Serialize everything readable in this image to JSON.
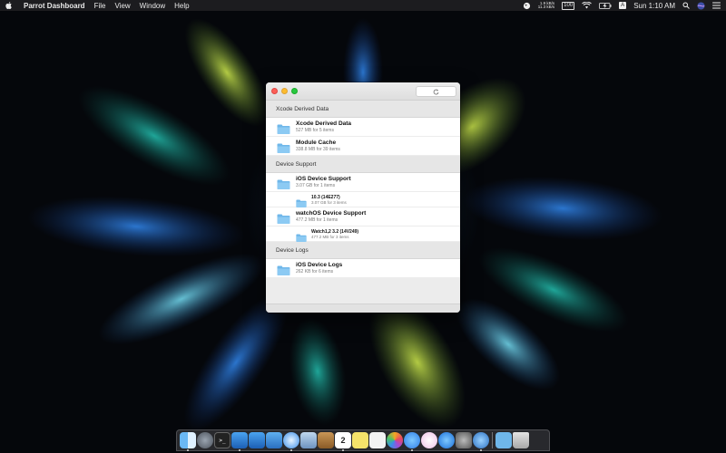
{
  "menubar": {
    "app_name": "Parrot Dashboard",
    "menus": [
      "File",
      "View",
      "Window",
      "Help"
    ],
    "net_up": "1.9 kB/s",
    "net_down": "11.3 kB/s",
    "clock": "Sun 1:10 AM",
    "input_source": "A",
    "badge": "100"
  },
  "window": {
    "sections": [
      {
        "header": "Xcode Derived Data",
        "rows": [
          {
            "name": "Xcode Derived Data",
            "detail": "527 MB for 5 items",
            "level": "top"
          },
          {
            "name": "Module Cache",
            "detail": "338.8 MB for 39 items",
            "level": "top"
          }
        ]
      },
      {
        "header": "Device Support",
        "rows": [
          {
            "name": "iOS Device Support",
            "detail": "3.07 GB for 1 items",
            "level": "top"
          },
          {
            "name": "10.3 (14E277)",
            "detail": "3.07 GB for 3 items",
            "level": "sub"
          },
          {
            "name": "watchOS Device Support",
            "detail": "477.2 MB for 1 items",
            "level": "top"
          },
          {
            "name": "Watch1,2 3.2 (14V249)",
            "detail": "477.2 MB for 3 items",
            "level": "sub"
          }
        ]
      },
      {
        "header": "Device Logs",
        "rows": [
          {
            "name": "iOS Device Logs",
            "detail": "262 KB for 6 items",
            "level": "top"
          }
        ]
      }
    ]
  },
  "dock": {
    "calendar_day": "2",
    "apps": [
      "finder-icon",
      "launchpad-icon",
      "terminal-icon",
      "xcode-icon",
      "xcode-beta-icon",
      "instruments-icon",
      "safari-icon",
      "preview-icon",
      "notes-icon",
      "calendar-icon",
      "stickies-icon",
      "textedit-icon",
      "photos-icon",
      "messages-icon",
      "itunes-icon",
      "app-store-icon",
      "system-preferences-icon",
      "parrot-icon",
      "downloads-folder-icon",
      "trash-icon"
    ]
  }
}
